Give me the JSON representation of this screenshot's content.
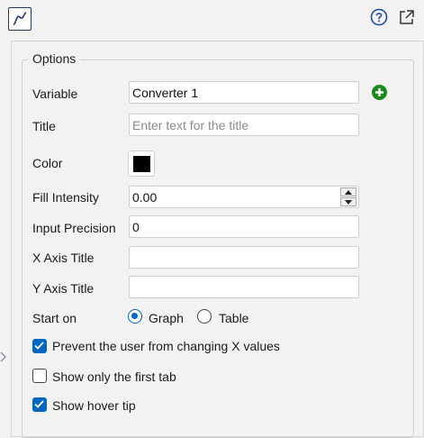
{
  "options": {
    "legend": "Options",
    "variable": {
      "label": "Variable",
      "value": "Converter 1"
    },
    "title": {
      "label": "Title",
      "placeholder": "Enter text for the title",
      "value": ""
    },
    "color": {
      "label": "Color",
      "value": "#000000"
    },
    "fill_intensity": {
      "label": "Fill Intensity",
      "value": "0.00"
    },
    "input_precision": {
      "label": "Input Precision",
      "value": "0"
    },
    "x_axis_title": {
      "label": "X Axis Title",
      "value": ""
    },
    "y_axis_title": {
      "label": "Y Axis Title",
      "value": ""
    },
    "start_on": {
      "label": "Start on",
      "options": [
        "Graph",
        "Table"
      ],
      "selected": "Graph"
    },
    "checkboxes": [
      {
        "label": "Prevent the user from changing X values",
        "checked": true
      },
      {
        "label": "Show only the first tab",
        "checked": false
      },
      {
        "label": "Show hover tip",
        "checked": true
      }
    ]
  },
  "icons": {
    "graph": "graph-icon",
    "help": "help-icon",
    "popout": "popout-icon",
    "add": "add-icon",
    "side_arrow": "chevron-right-icon"
  },
  "colors": {
    "accent": "#0067c0",
    "add_green": "#1a8a1a",
    "icon_blue": "#1f4e9c"
  }
}
